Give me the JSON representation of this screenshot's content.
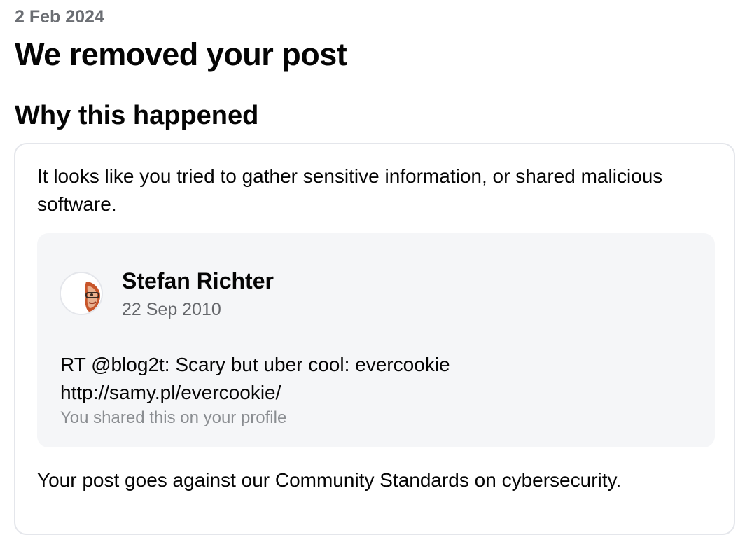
{
  "header": {
    "date": "2 Feb 2024",
    "title": "We removed your post"
  },
  "why": {
    "heading": "Why this happened",
    "reason": "It looks like you tried to gather sensitive information, or shared malicious software."
  },
  "post": {
    "author": "Stefan Richter",
    "date": "22 Sep 2010",
    "text_line1": "RT @blog2t: Scary but uber cool: evercookie",
    "text_line2": "http://samy.pl/evercookie/",
    "shared_note": "You shared this on your profile",
    "avatar_icon": "profile-photo"
  },
  "footer": {
    "standards_text": "Your post goes against our Community Standards on cybersecurity."
  }
}
